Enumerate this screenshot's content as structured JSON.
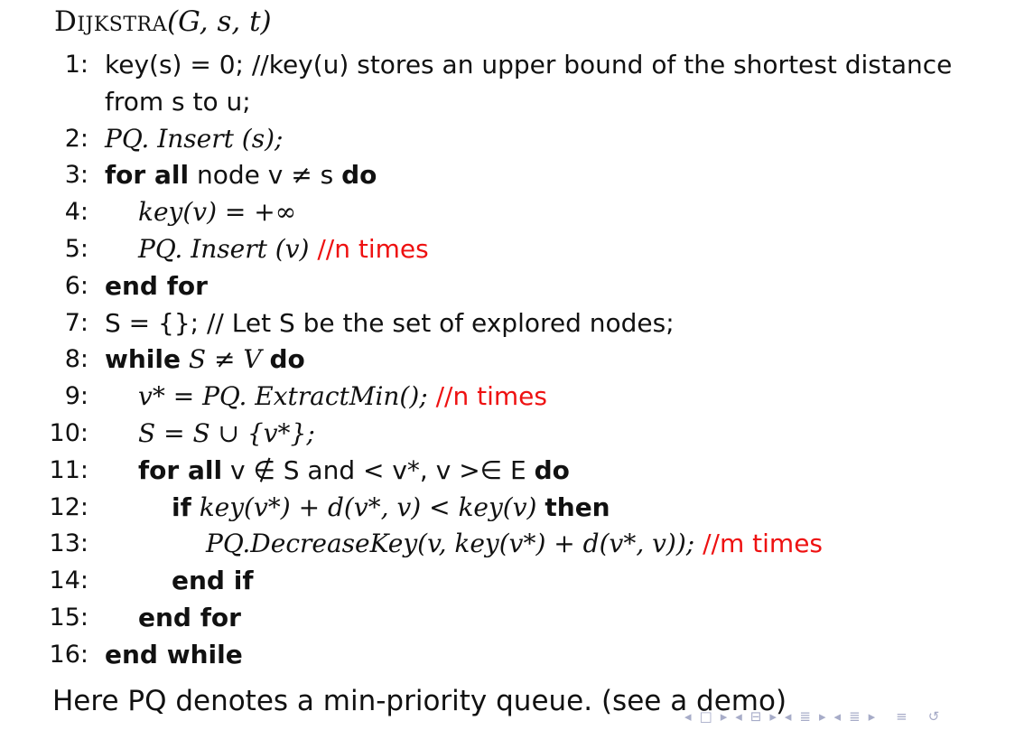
{
  "title": {
    "name": "Dijkstra",
    "args": "(G, s, t)"
  },
  "lines": [
    {
      "num": "1:",
      "parts": [
        "key(s) = 0; //key(u) stores an upper bound of the shortest distance"
      ]
    },
    {
      "num": "",
      "parts": [
        "from s to u;"
      ]
    },
    {
      "num": "2:",
      "parts": [
        "PQ. Insert (s);"
      ]
    },
    {
      "num": "3:",
      "parts": [
        "for all",
        "node v ≠ s",
        "do"
      ]
    },
    {
      "num": "4:",
      "parts": [
        "key(v) = +∞"
      ]
    },
    {
      "num": "5:",
      "parts": [
        "PQ. Insert (v)",
        "//n times"
      ]
    },
    {
      "num": "6:",
      "parts": [
        "end for"
      ]
    },
    {
      "num": "7:",
      "parts": [
        "S = {}; // Let S be the set of explored nodes;"
      ]
    },
    {
      "num": "8:",
      "parts": [
        "while",
        "S ≠ V",
        "do"
      ]
    },
    {
      "num": "9:",
      "parts": [
        "v* = PQ. ExtractMin();",
        "//n times"
      ]
    },
    {
      "num": "10:",
      "parts": [
        "S = S ∪ {v*};"
      ]
    },
    {
      "num": "11:",
      "parts": [
        "for all",
        "v ∉ S and < v*, v >∈ E",
        "do"
      ]
    },
    {
      "num": "12:",
      "parts": [
        "if",
        "key(v*) + d(v*, v) < key(v)",
        "then"
      ]
    },
    {
      "num": "13:",
      "parts": [
        "PQ.DecreaseKey(v, key(v*) + d(v*, v));",
        "//m times"
      ]
    },
    {
      "num": "14:",
      "parts": [
        "end if"
      ]
    },
    {
      "num": "15:",
      "parts": [
        "end for"
      ]
    },
    {
      "num": "16:",
      "parts": [
        "end while"
      ]
    }
  ],
  "footer": "Here PQ denotes a min-priority queue. (see a demo)",
  "colors": {
    "accent": "#ee1111",
    "nav": "#a7acc8"
  },
  "nav_icons": [
    "nav-left-arrow-icon",
    "nav-frame-icon",
    "nav-right-arrow-icon",
    "nav-subsection-icon",
    "nav-section-icon",
    "nav-search-icon"
  ]
}
